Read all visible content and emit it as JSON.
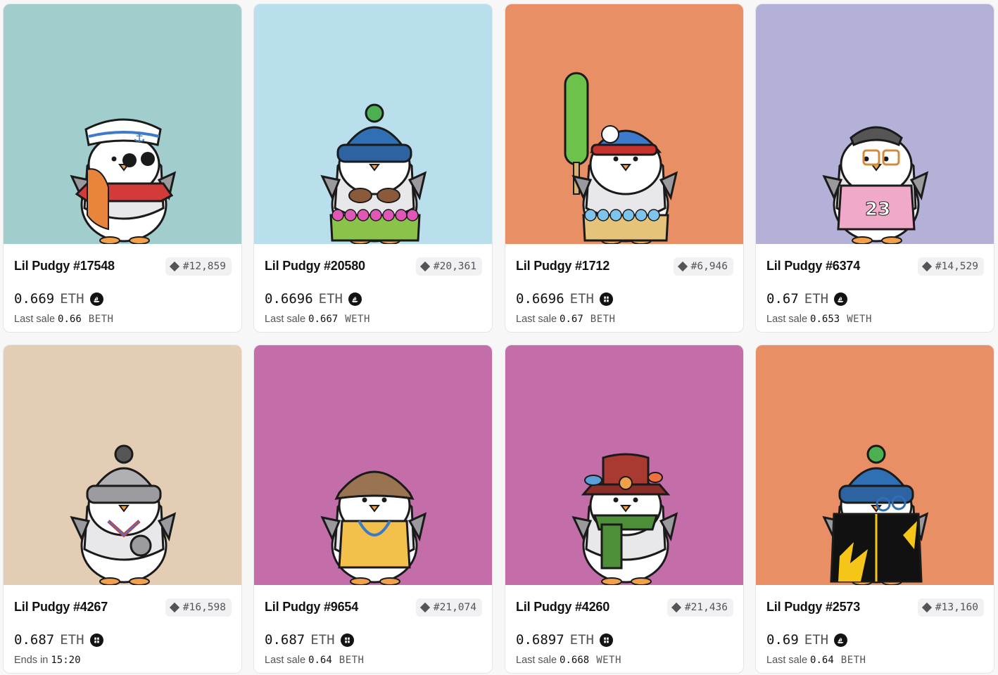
{
  "cards": [
    {
      "name": "Lil Pudgy #17548",
      "rank": "#12,859",
      "price": "0.669",
      "currency": "ETH",
      "market_icon": "opensea-icon",
      "sub_label": "Last sale",
      "sub_value": "0.66",
      "sub_token": "BETH",
      "bg": "#a2cdcd",
      "accessory": "sailor-hat"
    },
    {
      "name": "Lil Pudgy #20580",
      "rank": "#20,361",
      "price": "0.6696",
      "currency": "ETH",
      "market_icon": "opensea-icon",
      "sub_label": "Last sale",
      "sub_value": "0.667",
      "sub_token": "WETH",
      "bg": "#b9dfed",
      "accessory": "blue-beanie"
    },
    {
      "name": "Lil Pudgy #1712",
      "rank": "#6,946",
      "price": "0.6696",
      "currency": "ETH",
      "market_icon": "blur-icon",
      "sub_label": "Last sale",
      "sub_value": "0.67",
      "sub_token": "BETH",
      "bg": "#e98f66",
      "accessory": "cap-popsicle"
    },
    {
      "name": "Lil Pudgy #6374",
      "rank": "#14,529",
      "price": "0.67",
      "currency": "ETH",
      "market_icon": "opensea-icon",
      "sub_label": "Last sale",
      "sub_value": "0.653",
      "sub_token": "WETH",
      "bg": "#b4b1d9",
      "accessory": "glasses-jersey"
    },
    {
      "name": "Lil Pudgy #4267",
      "rank": "#16,598",
      "price": "0.687",
      "currency": "ETH",
      "market_icon": "blur-icon",
      "sub_label": "Ends in",
      "sub_value": "15:20",
      "sub_token": "",
      "bg": "#e3cdb5",
      "accessory": "grey-beanie-medal"
    },
    {
      "name": "Lil Pudgy #9654",
      "rank": "#21,074",
      "price": "0.687",
      "currency": "ETH",
      "market_icon": "blur-icon",
      "sub_label": "Last sale",
      "sub_value": "0.64",
      "sub_token": "BETH",
      "bg": "#c36ea8",
      "accessory": "flat-cap-tank"
    },
    {
      "name": "Lil Pudgy #4260",
      "rank": "#21,436",
      "price": "0.6897",
      "currency": "ETH",
      "market_icon": "blur-icon",
      "sub_label": "Last sale",
      "sub_value": "0.668",
      "sub_token": "WETH",
      "bg": "#c36ea8",
      "accessory": "bucket-hat-scarf"
    },
    {
      "name": "Lil Pudgy #2573",
      "rank": "#13,160",
      "price": "0.69",
      "currency": "ETH",
      "market_icon": "opensea-icon",
      "sub_label": "Last sale",
      "sub_value": "0.64",
      "sub_token": "BETH",
      "bg": "#e98f66",
      "accessory": "blue-beanie-jacket"
    }
  ]
}
